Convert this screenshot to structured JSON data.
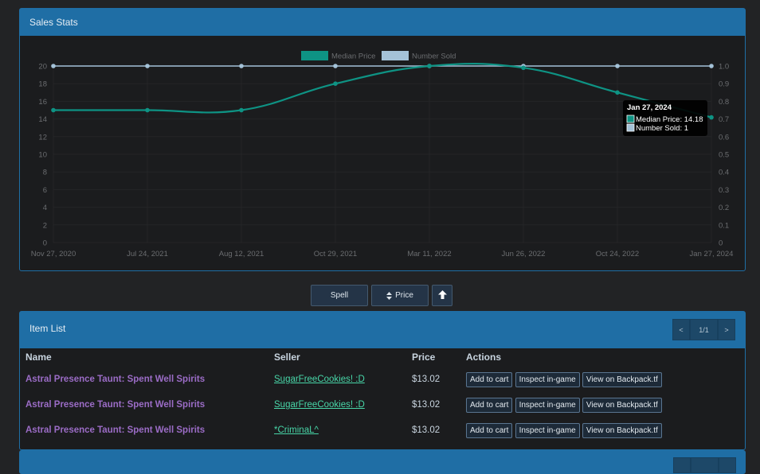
{
  "sales_stats": {
    "title": "Sales Stats"
  },
  "chart_data": {
    "type": "line",
    "categories": [
      "Nov 27, 2020",
      "Jul 24, 2021",
      "Aug 12, 2021",
      "Oct 29, 2021",
      "Mar 11, 2022",
      "Jun 26, 2022",
      "Oct 24, 2022",
      "Jan 27, 2024"
    ],
    "series": [
      {
        "name": "Median Price",
        "axis": "left",
        "color": "#0e9384",
        "values": [
          15,
          15,
          15,
          18,
          20,
          19.8,
          17,
          14.18
        ]
      },
      {
        "name": "Number Sold",
        "axis": "right",
        "color": "#a4c2d8",
        "values": [
          1,
          1,
          1,
          1,
          1,
          1,
          1,
          1
        ]
      }
    ],
    "y_left": {
      "range": [
        0,
        20
      ],
      "ticks": [
        "0",
        "2",
        "4",
        "6",
        "8",
        "10",
        "12",
        "14",
        "16",
        "18",
        "20"
      ]
    },
    "y_right": {
      "range": [
        0,
        1
      ],
      "ticks": [
        "0",
        "0.1",
        "0.2",
        "0.3",
        "0.4",
        "0.5",
        "0.6",
        "0.7",
        "0.8",
        "0.9",
        "1.0"
      ]
    },
    "legend_position": "top-center",
    "grid": true,
    "tooltip": {
      "title": "Jan 27, 2024",
      "lines": [
        "Median Price: 14.18",
        "Number Sold: 1"
      ]
    }
  },
  "sort": {
    "spell_label": "Spell",
    "price_label": "Price",
    "price_icon": "sort-icon",
    "direction_icon": "arrow-up-icon"
  },
  "item_list": {
    "title": "Item List",
    "pager": {
      "prev": "<",
      "page": "1/1",
      "next": ">"
    },
    "columns": [
      "Name",
      "Seller",
      "Price",
      "Actions"
    ],
    "rows": [
      {
        "name": "Astral Presence Taunt: Spent Well Spirits",
        "seller": "SugarFreeCookies! :D",
        "price": "$13.02"
      },
      {
        "name": "Astral Presence Taunt: Spent Well Spirits",
        "seller": "SugarFreeCookies! :D",
        "price": "$13.02"
      },
      {
        "name": "Astral Presence Taunt: Spent Well Spirits",
        "seller": "*CriminaL^",
        "price": "$13.02"
      }
    ],
    "actions": {
      "add": "Add to cart",
      "inspect": "Inspect in-game",
      "backpack": "View on Backpack.tf"
    }
  }
}
